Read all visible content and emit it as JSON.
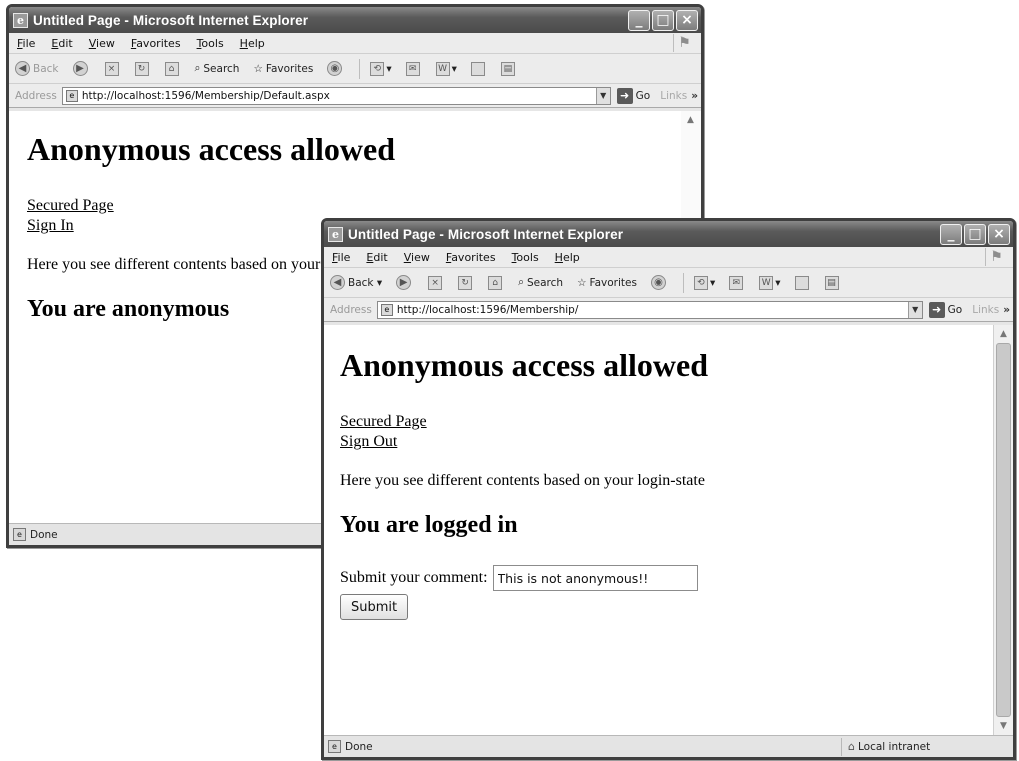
{
  "back_window": {
    "title": "Untitled Page - Microsoft Internet Explorer",
    "menu": [
      "File",
      "Edit",
      "View",
      "Favorites",
      "Tools",
      "Help"
    ],
    "toolbar": {
      "back_label": "Back",
      "search_label": "Search",
      "favorites_label": "Favorites"
    },
    "address": {
      "label": "Address",
      "url": "http://localhost:1596/Membership/Default.aspx",
      "go_label": "Go",
      "links_label": "Links",
      "links_more": "»"
    },
    "content": {
      "heading": "Anonymous access allowed",
      "link_secured": "Secured Page",
      "link_auth": "Sign In",
      "description": "Here you see different contents based on your login-state",
      "state_heading": "You are anonymous"
    },
    "status": {
      "text": "Done"
    }
  },
  "front_window": {
    "title": "Untitled Page - Microsoft Internet Explorer",
    "menu": [
      "File",
      "Edit",
      "View",
      "Favorites",
      "Tools",
      "Help"
    ],
    "toolbar": {
      "back_label": "Back",
      "search_label": "Search",
      "favorites_label": "Favorites"
    },
    "address": {
      "label": "Address",
      "url": "http://localhost:1596/Membership/",
      "go_label": "Go",
      "links_label": "Links",
      "links_more": "»"
    },
    "content": {
      "heading": "Anonymous access allowed",
      "link_secured": "Secured Page",
      "link_auth": "Sign Out",
      "description": "Here you see different contents based on your login-state",
      "state_heading": "You are logged in",
      "comment_label": "Submit your comment:",
      "comment_value": "This is not anonymous!!",
      "submit_label": "Submit"
    },
    "status": {
      "text": "Done",
      "zone": "Local intranet"
    }
  }
}
